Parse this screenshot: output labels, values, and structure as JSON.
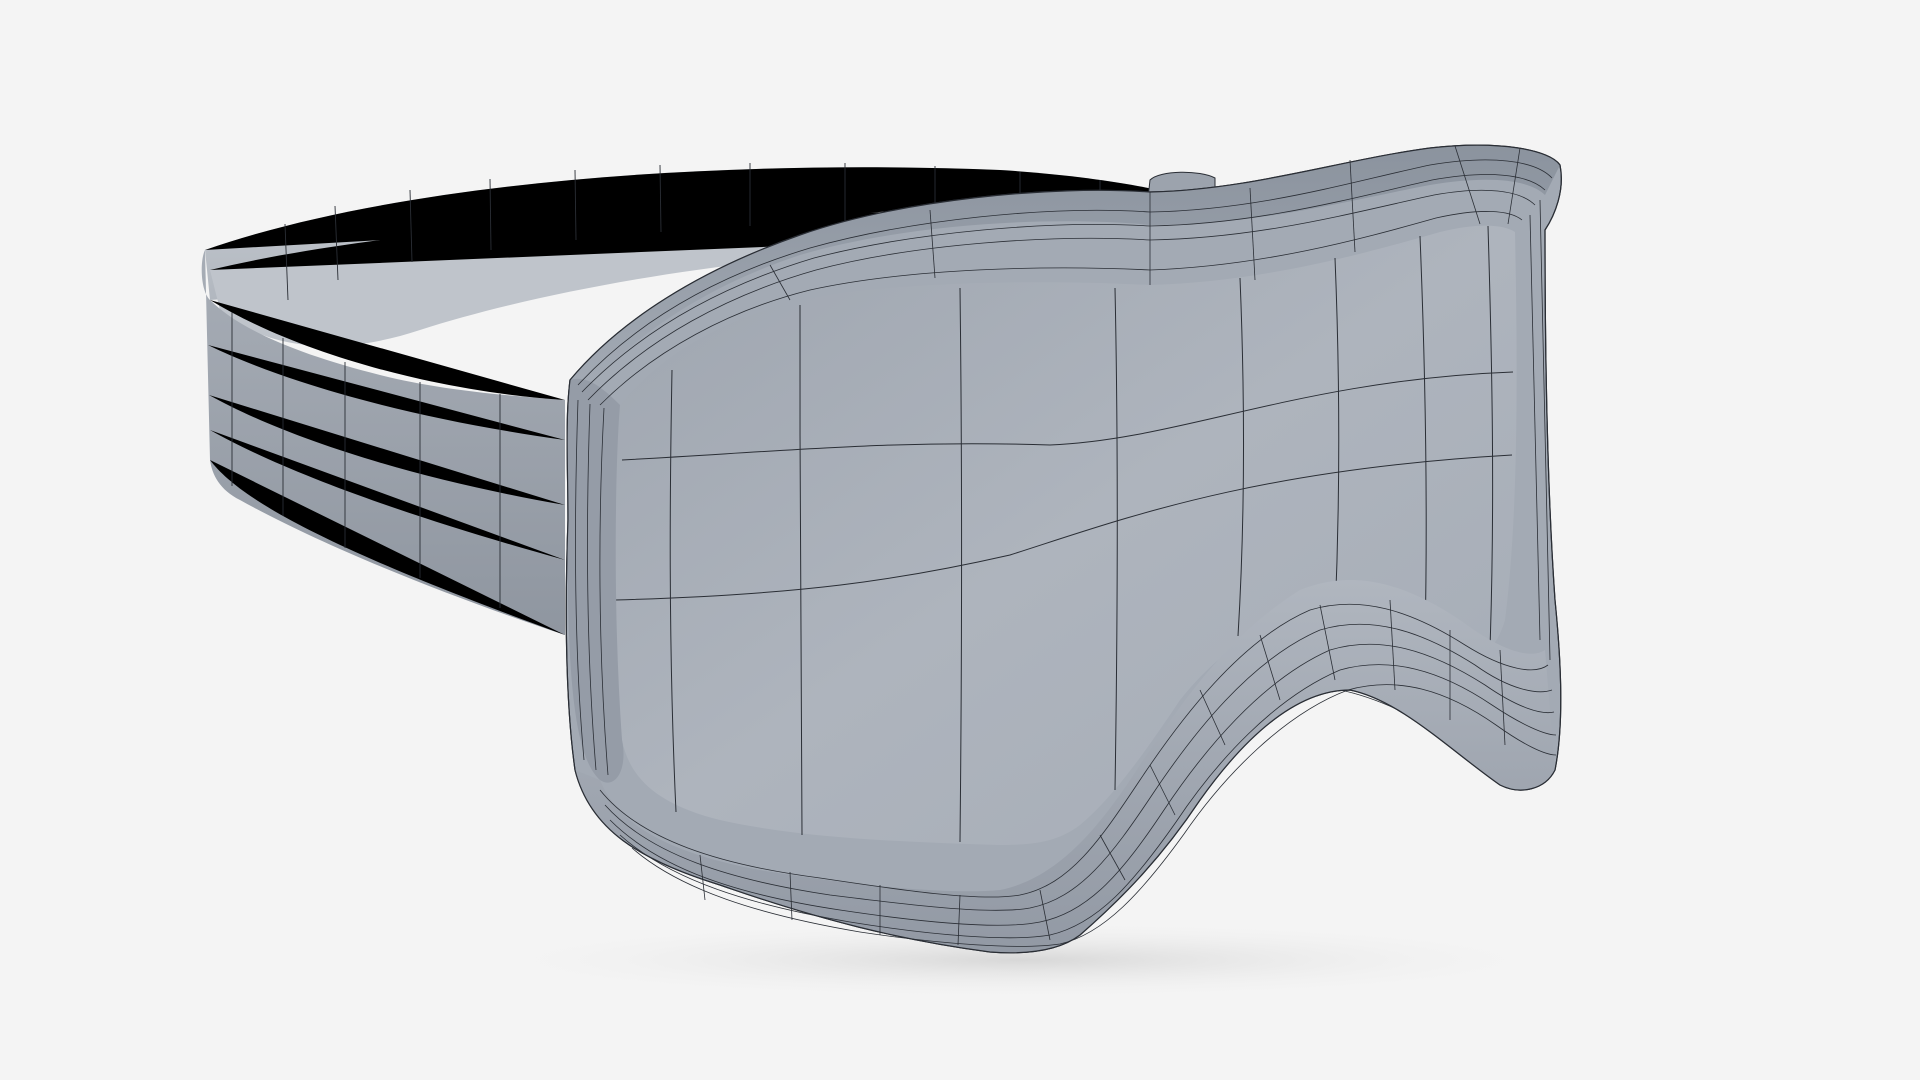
{
  "scene": {
    "background_color": "#f4f4f4",
    "object": "goggles-wireframe-model",
    "render_mode": "clay-with-wireframe-overlay",
    "colors": {
      "strap_face": "#9aa1ab",
      "strap_top": "#b4bac2",
      "strap_inner": "#c2c6cc",
      "frame": "#a4abb5",
      "frame_top": "#8a929d",
      "lens": "#a9b0b9",
      "lens_light": "#b6bcc4",
      "inner_cavity": "#bdb7ae",
      "wire": "#2a2e35",
      "shadow": "#d9d9d9"
    },
    "strap_vertical_divisions": 22,
    "lens_vertical_divisions": 8
  }
}
